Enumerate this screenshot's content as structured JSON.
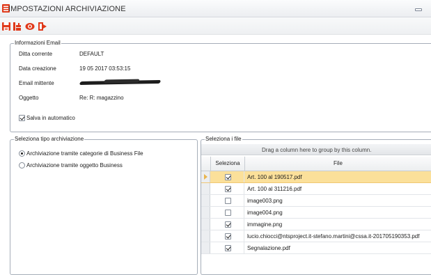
{
  "window": {
    "title": "IMPOSTAZIONI ARCHIVIAZIONE",
    "app_icon": "archive-app-icon",
    "minimize_icon": "minimize-icon"
  },
  "toolbar": {
    "buttons": [
      {
        "icon": "save-icon"
      },
      {
        "icon": "archive-tool-icon"
      },
      {
        "icon": "view-icon"
      },
      {
        "icon": "exit-icon"
      }
    ]
  },
  "email_info": {
    "legend": "Informazioni Email",
    "ditta_label": "Ditta corrente",
    "ditta_value": "DEFAULT",
    "data_label": "Data creazione",
    "data_value": "19 05 2017 03:53:15",
    "mittente_label": "Email mittente",
    "oggetto_label": "Oggetto",
    "oggetto_value": "Re: R: magazzino",
    "autosave_label": "Salva in automatico",
    "autosave_checked": true
  },
  "archive_type": {
    "legend": "Seleziona tipo archiviazione",
    "options": [
      {
        "label": "Archiviazione tramite categorie di Business File",
        "selected": true
      },
      {
        "label": "Archiviazione tramite oggetto Business",
        "selected": false
      }
    ]
  },
  "files": {
    "legend": "Seleziona i file",
    "group_hint": "Drag a column here to group by this column.",
    "col_select": "Seleziona",
    "col_file": "File",
    "rows": [
      {
        "checked": true,
        "file": "Art. 100 al 190517.pdf"
      },
      {
        "checked": true,
        "file": "Art. 100 al 311216.pdf"
      },
      {
        "checked": false,
        "file": "image003.png"
      },
      {
        "checked": false,
        "file": "image004.png"
      },
      {
        "checked": true,
        "file": "immagine.png"
      },
      {
        "checked": true,
        "file": "lucio.chiocci@ntsproject.it-stefano.martini@cssa.it-201705190353.pdf"
      },
      {
        "checked": true,
        "file": "Segnalazione.pdf"
      }
    ],
    "selected_row": 0
  },
  "colors": {
    "accent": "#e0391a",
    "selected_row": "#fbe09a",
    "border": "#a5adb8"
  }
}
